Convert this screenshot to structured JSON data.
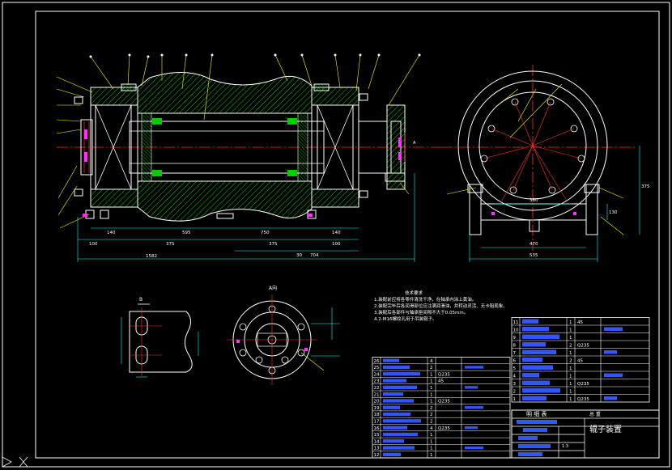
{
  "drawing": {
    "title_block_name": "辊子装置",
    "bom_header": "明 细 表",
    "bom_header_right": "总 重",
    "scale": "1:3"
  },
  "views": {
    "section_a_label": "A",
    "view_a_label": "A向",
    "view_b_label": "B"
  },
  "tech_requirements": {
    "title": "技术要求",
    "lines": [
      "1.装配前应将各零件清洗干净，在轴承内涂上黄油。",
      "2.装配完毕后各润滑部位应注满润滑油，并转动灵活、无卡阻现象。",
      "3.装配后各部件与轴承座间隙不大于0.05mm。",
      "4.2-M16螺纹孔用于吊装辊子。"
    ]
  },
  "dims_main": [
    "140",
    "100",
    "375",
    "595",
    "750",
    "375",
    "140",
    "100",
    "30",
    "704",
    "1582"
  ],
  "dims_side": [
    "380",
    "470",
    "535",
    "130",
    "375"
  ],
  "bom_left": {
    "rows": [
      {
        "no": "26",
        "qty": "4",
        "mat": ""
      },
      {
        "no": "25",
        "qty": "2",
        "mat": ""
      },
      {
        "no": "24",
        "qty": "1",
        "mat": "Q235"
      },
      {
        "no": "23",
        "qty": "1",
        "mat": "45"
      },
      {
        "no": "22",
        "qty": "1",
        "mat": ""
      },
      {
        "no": "21",
        "qty": "1",
        "mat": ""
      },
      {
        "no": "20",
        "qty": "1",
        "mat": "Q235"
      },
      {
        "no": "19",
        "qty": "2",
        "mat": ""
      },
      {
        "no": "18",
        "qty": "2",
        "mat": ""
      },
      {
        "no": "17",
        "qty": "2",
        "mat": ""
      },
      {
        "no": "16",
        "qty": "4",
        "mat": "Q235"
      },
      {
        "no": "15",
        "qty": "1",
        "mat": ""
      },
      {
        "no": "14",
        "qty": "1",
        "mat": ""
      },
      {
        "no": "13",
        "qty": "1",
        "mat": ""
      },
      {
        "no": "12",
        "qty": "1",
        "mat": ""
      }
    ]
  },
  "bom_right": {
    "rows": [
      {
        "no": "11",
        "qty": "1",
        "mat": "45"
      },
      {
        "no": "10",
        "qty": "1",
        "mat": ""
      },
      {
        "no": "9",
        "qty": "1",
        "mat": ""
      },
      {
        "no": "8",
        "qty": "2",
        "mat": "Q235"
      },
      {
        "no": "7",
        "qty": "1",
        "mat": ""
      },
      {
        "no": "6",
        "qty": "2",
        "mat": "45"
      },
      {
        "no": "5",
        "qty": "1",
        "mat": ""
      },
      {
        "no": "4",
        "qty": "1",
        "mat": ""
      },
      {
        "no": "3",
        "qty": "1",
        "mat": "Q235"
      },
      {
        "no": "2",
        "qty": "1",
        "mat": ""
      },
      {
        "no": "1",
        "qty": "1",
        "mat": "Q235"
      }
    ]
  },
  "colors": {
    "outline": "#ffffff",
    "hatch": "#00cc00",
    "center": "#ff3030",
    "dim": "#00ffff",
    "leader": "#ffff00",
    "fill_blue": "#3355ff",
    "magenta": "#ff33ff"
  }
}
